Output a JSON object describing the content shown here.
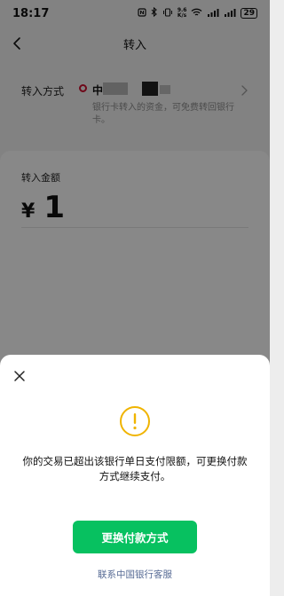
{
  "status_bar": {
    "time": "18:17",
    "network_speed_top": "9.6",
    "network_speed_bottom": "K/s",
    "battery": "29"
  },
  "nav": {
    "title": "转入",
    "back_icon": "chevron-left-icon"
  },
  "source": {
    "label": "转入方式",
    "bank_name": "中",
    "description": "银行卡转入的资金，可免费转回银行卡。",
    "bank_logo_color": "#c8102e"
  },
  "amount": {
    "label": "转入金额",
    "currency": "¥",
    "value": "1"
  },
  "dialog": {
    "close_icon": "close-icon",
    "warning_icon": "exclamation-circle-icon",
    "message": "你的交易已超出该银行单日支付限额，可更换付款方式继续支付。",
    "primary_button": "更换付款方式",
    "contact_link": "联系中国银行客服",
    "accent_color": "#07c160",
    "warning_color": "#f0b400",
    "link_color": "#576b95"
  }
}
